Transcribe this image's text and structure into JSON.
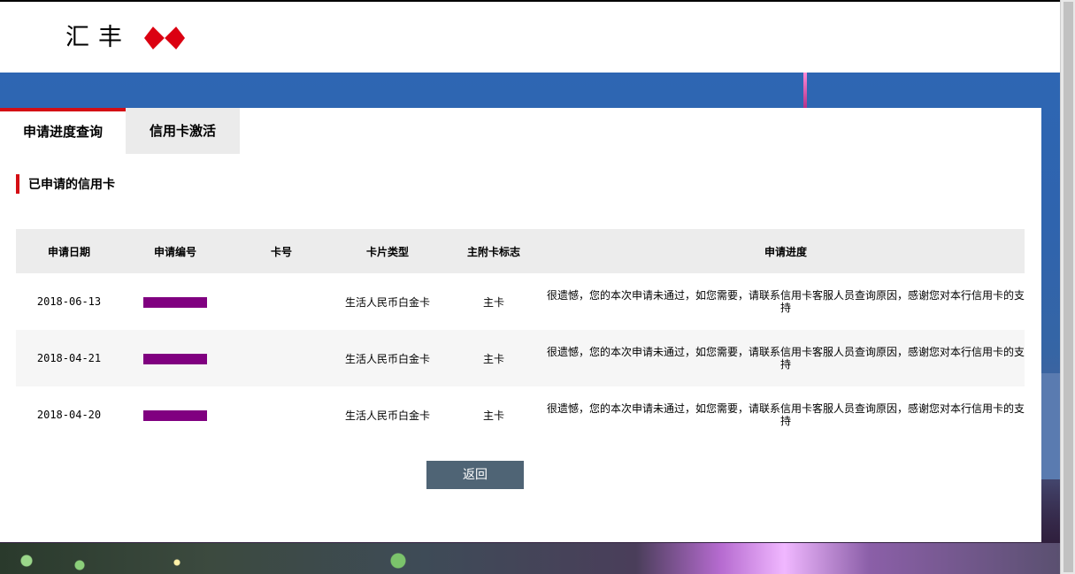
{
  "header": {
    "logo_text": "汇丰",
    "logo_mark": "hsbc-hexagon-icon",
    "brand_color": "#db0011"
  },
  "tabs": [
    {
      "label": "申请进度查询",
      "active": true
    },
    {
      "label": "信用卡激活",
      "active": false
    }
  ],
  "section": {
    "title": "已申请的信用卡",
    "accent": "#d40e14"
  },
  "table": {
    "columns": [
      "申请日期",
      "申请编号",
      "卡号",
      "卡片类型",
      "主附卡标志",
      "申请进度"
    ],
    "rows": [
      {
        "date": "2018-06-13",
        "card_number": "",
        "card_type": "生活人民币白金卡",
        "flag": "主卡",
        "progress": "很遗憾，您的本次申请未通过，如您需要，请联系信用卡客服人员查询原因，感谢您对本行信用卡的支持"
      },
      {
        "date": "2018-04-21",
        "card_number": "",
        "card_type": "生活人民币白金卡",
        "flag": "主卡",
        "progress": "很遗憾，您的本次申请未通过，如您需要，请联系信用卡客服人员查询原因，感谢您对本行信用卡的支持"
      },
      {
        "date": "2018-04-20",
        "card_number": "",
        "card_type": "生活人民币白金卡",
        "flag": "主卡",
        "progress": "很遗憾，您的本次申请未通过，如您需要，请联系信用卡客服人员查询原因，感谢您对本行信用卡的支持"
      }
    ]
  },
  "actions": {
    "back_label": "返回",
    "back_color": "#4f6475"
  }
}
